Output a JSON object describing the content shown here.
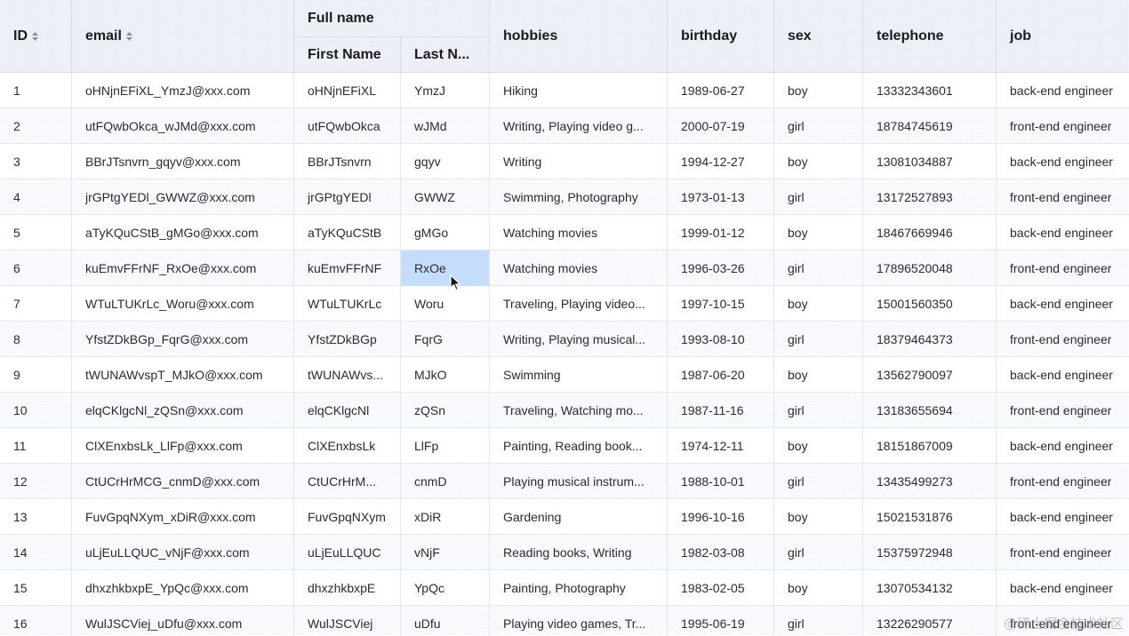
{
  "columns": {
    "id": "ID",
    "email": "email",
    "full_name": "Full name",
    "first_name": "First Name",
    "last_name": "Last N...",
    "hobbies": "hobbies",
    "birthday": "birthday",
    "sex": "sex",
    "telephone": "telephone",
    "job": "job"
  },
  "selected_cell": {
    "row": 5,
    "column": "last_name"
  },
  "colors": {
    "selection": "#c5dcfb",
    "header_bg": "#eef1f7",
    "grid_line": "#e3e6ec"
  },
  "rows": [
    {
      "id": "1",
      "email": "oHNjnEFiXL_YmzJ@xxx.com",
      "first_name": "oHNjnEFiXL",
      "last_name": "YmzJ",
      "hobbies": "Hiking",
      "birthday": "1989-06-27",
      "sex": "boy",
      "telephone": "13332343601",
      "job": "back-end engineer"
    },
    {
      "id": "2",
      "email": "utFQwbOkca_wJMd@xxx.com",
      "first_name": "utFQwbOkca",
      "last_name": "wJMd",
      "hobbies": "Writing, Playing video g...",
      "birthday": "2000-07-19",
      "sex": "girl",
      "telephone": "18784745619",
      "job": "front-end engineer"
    },
    {
      "id": "3",
      "email": "BBrJTsnvrn_gqyv@xxx.com",
      "first_name": "BBrJTsnvrn",
      "last_name": "gqyv",
      "hobbies": "Writing",
      "birthday": "1994-12-27",
      "sex": "boy",
      "telephone": "13081034887",
      "job": "back-end engineer"
    },
    {
      "id": "4",
      "email": "jrGPtgYEDl_GWWZ@xxx.com",
      "first_name": "jrGPtgYEDl",
      "last_name": "GWWZ",
      "hobbies": "Swimming, Photography",
      "birthday": "1973-01-13",
      "sex": "girl",
      "telephone": "13172527893",
      "job": "front-end engineer"
    },
    {
      "id": "5",
      "email": "aTyKQuCStB_gMGo@xxx.com",
      "first_name": "aTyKQuCStB",
      "last_name": "gMGo",
      "hobbies": "Watching movies",
      "birthday": "1999-01-12",
      "sex": "boy",
      "telephone": "18467669946",
      "job": "back-end engineer"
    },
    {
      "id": "6",
      "email": "kuEmvFFrNF_RxOe@xxx.com",
      "first_name": "kuEmvFFrNF",
      "last_name": "RxOe",
      "hobbies": "Watching movies",
      "birthday": "1996-03-26",
      "sex": "girl",
      "telephone": "17896520048",
      "job": "front-end engineer"
    },
    {
      "id": "7",
      "email": "WTuLTUKrLc_Woru@xxx.com",
      "first_name": "WTuLTUKrLc",
      "last_name": "Woru",
      "hobbies": "Traveling, Playing video...",
      "birthday": "1997-10-15",
      "sex": "boy",
      "telephone": "15001560350",
      "job": "back-end engineer"
    },
    {
      "id": "8",
      "email": "YfstZDkBGp_FqrG@xxx.com",
      "first_name": "YfstZDkBGp",
      "last_name": "FqrG",
      "hobbies": "Writing, Playing musical...",
      "birthday": "1993-08-10",
      "sex": "girl",
      "telephone": "18379464373",
      "job": "front-end engineer"
    },
    {
      "id": "9",
      "email": "tWUNAWvspT_MJkO@xxx.com",
      "first_name": "tWUNAWvs...",
      "last_name": "MJkO",
      "hobbies": "Swimming",
      "birthday": "1987-06-20",
      "sex": "boy",
      "telephone": "13562790097",
      "job": "back-end engineer"
    },
    {
      "id": "10",
      "email": "elqCKlgcNl_zQSn@xxx.com",
      "first_name": "elqCKlgcNl",
      "last_name": "zQSn",
      "hobbies": "Traveling, Watching mo...",
      "birthday": "1987-11-16",
      "sex": "girl",
      "telephone": "13183655694",
      "job": "front-end engineer"
    },
    {
      "id": "11",
      "email": "ClXEnxbsLk_LlFp@xxx.com",
      "first_name": "ClXEnxbsLk",
      "last_name": "LlFp",
      "hobbies": "Painting, Reading book...",
      "birthday": "1974-12-11",
      "sex": "boy",
      "telephone": "18151867009",
      "job": "back-end engineer"
    },
    {
      "id": "12",
      "email": "CtUCrHrMCG_cnmD@xxx.com",
      "first_name": "CtUCrHrM...",
      "last_name": "cnmD",
      "hobbies": "Playing musical instrum...",
      "birthday": "1988-10-01",
      "sex": "girl",
      "telephone": "13435499273",
      "job": "front-end engineer"
    },
    {
      "id": "13",
      "email": "FuvGpqNXym_xDiR@xxx.com",
      "first_name": "FuvGpqNXym",
      "last_name": "xDiR",
      "hobbies": "Gardening",
      "birthday": "1996-10-16",
      "sex": "boy",
      "telephone": "15021531876",
      "job": "back-end engineer"
    },
    {
      "id": "14",
      "email": "uLjEuLLQUC_vNjF@xxx.com",
      "first_name": "uLjEuLLQUC",
      "last_name": "vNjF",
      "hobbies": "Reading books, Writing",
      "birthday": "1982-03-08",
      "sex": "girl",
      "telephone": "15375972948",
      "job": "front-end engineer"
    },
    {
      "id": "15",
      "email": "dhxzhkbxpE_YpQc@xxx.com",
      "first_name": "dhxzhkbxpE",
      "last_name": "YpQc",
      "hobbies": "Painting, Photography",
      "birthday": "1983-02-05",
      "sex": "boy",
      "telephone": "13070534132",
      "job": "back-end engineer"
    },
    {
      "id": "16",
      "email": "WulJSCViej_uDfu@xxx.com",
      "first_name": "WulJSCViej",
      "last_name": "uDfu",
      "hobbies": "Playing video games, Tr...",
      "birthday": "1995-06-19",
      "sex": "girl",
      "telephone": "13226290577",
      "job": "front-end engineer"
    }
  ],
  "watermark": "@稀土掘金技术社区"
}
